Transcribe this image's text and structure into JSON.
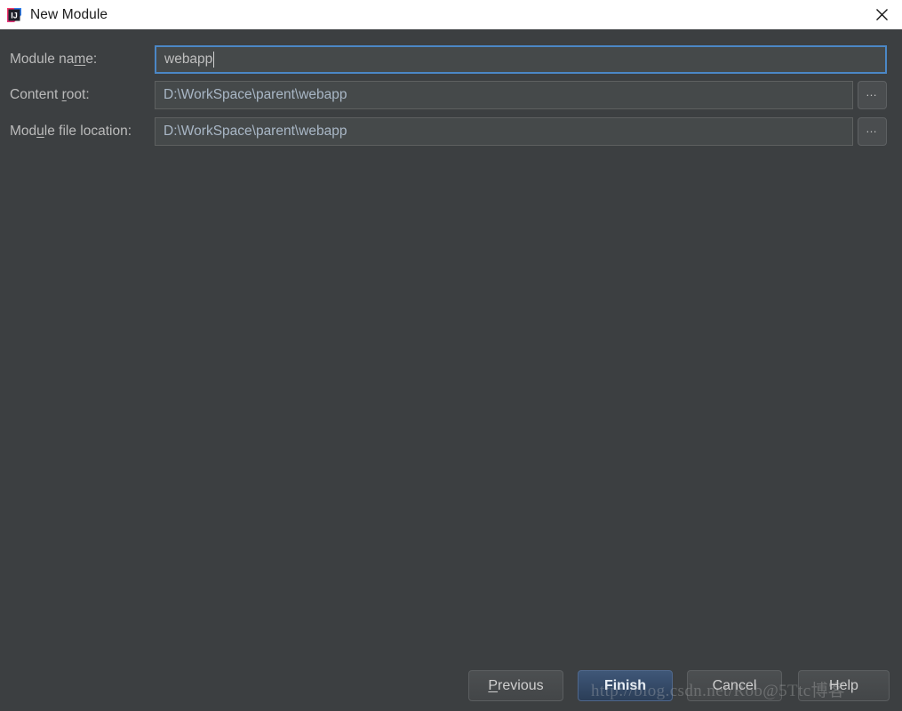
{
  "window": {
    "title": "New Module",
    "icon": "intellij-idea-logo",
    "close_label": "✕",
    "background_color": "#3c3f41",
    "titlebar_color": "#ffffff"
  },
  "form": {
    "rows": [
      {
        "label_before": "Module na",
        "label_mnemonic": "m",
        "label_after": "e:",
        "value": "webapp",
        "focused": true,
        "has_browse": false
      },
      {
        "label_before": "Content ",
        "label_mnemonic": "r",
        "label_after": "oot:",
        "value": "D:\\WorkSpace\\parent\\webapp",
        "focused": false,
        "has_browse": true
      },
      {
        "label_before": "Mod",
        "label_mnemonic": "u",
        "label_after": "le file location:",
        "value": "D:\\WorkSpace\\parent\\webapp",
        "focused": false,
        "has_browse": true
      }
    ],
    "browse_label": "…"
  },
  "buttons": {
    "previous": {
      "before": "",
      "mnemonic": "P",
      "after": "revious"
    },
    "finish": {
      "before": "",
      "mnemonic": "F",
      "after": "inish"
    },
    "cancel": {
      "label": "Cancel"
    },
    "help": {
      "label": "Help"
    }
  },
  "watermark": {
    "text": "http://blog.csdn.net/Rob@5Ttc",
    "suffix": "博客"
  },
  "colors": {
    "accent": "#4b87c6",
    "primary_button": "#2b3e58",
    "field_background": "#45494a",
    "field_text": "#a9b7c6",
    "label_text": "#bbbbbb"
  }
}
